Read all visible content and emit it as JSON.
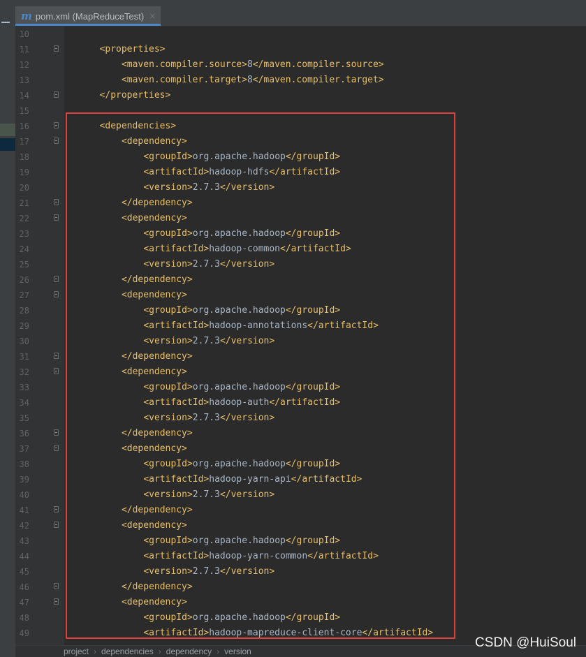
{
  "tab": {
    "icon": "m",
    "title": "pom.xml (MapReduceTest)",
    "close": "×"
  },
  "code_lines": [
    {
      "n": "10",
      "indent": 0,
      "parts": []
    },
    {
      "n": "11",
      "indent": 3,
      "fold": true,
      "parts": [
        {
          "t": "tag",
          "s": "<properties>"
        }
      ]
    },
    {
      "n": "12",
      "indent": 7,
      "parts": [
        {
          "t": "tag",
          "s": "<maven.compiler.source>"
        },
        {
          "t": "val",
          "s": "8"
        },
        {
          "t": "tag",
          "s": "</maven.compiler.source>"
        }
      ]
    },
    {
      "n": "13",
      "indent": 7,
      "parts": [
        {
          "t": "tag",
          "s": "<maven.compiler.target>"
        },
        {
          "t": "val",
          "s": "8"
        },
        {
          "t": "tag",
          "s": "</maven.compiler.target>"
        }
      ]
    },
    {
      "n": "14",
      "indent": 3,
      "fold": true,
      "parts": [
        {
          "t": "tag",
          "s": "</properties>"
        }
      ]
    },
    {
      "n": "15",
      "indent": 0,
      "parts": []
    },
    {
      "n": "16",
      "indent": 3,
      "fold": true,
      "parts": [
        {
          "t": "tag",
          "s": "<dependencies>"
        }
      ]
    },
    {
      "n": "17",
      "indent": 7,
      "fold": true,
      "parts": [
        {
          "t": "tag",
          "s": "<dependency>"
        }
      ]
    },
    {
      "n": "18",
      "indent": 11,
      "parts": [
        {
          "t": "tag",
          "s": "<groupId>"
        },
        {
          "t": "val",
          "s": "org.apache.hadoop"
        },
        {
          "t": "tag",
          "s": "</groupId>"
        }
      ]
    },
    {
      "n": "19",
      "indent": 11,
      "parts": [
        {
          "t": "tag",
          "s": "<artifactId>"
        },
        {
          "t": "val",
          "s": "hadoop-hdfs"
        },
        {
          "t": "tag",
          "s": "</artifactId>"
        }
      ]
    },
    {
      "n": "20",
      "indent": 11,
      "parts": [
        {
          "t": "tag",
          "s": "<version>"
        },
        {
          "t": "val",
          "s": "2.7.3"
        },
        {
          "t": "tag",
          "s": "</version>"
        }
      ]
    },
    {
      "n": "21",
      "indent": 7,
      "fold": true,
      "parts": [
        {
          "t": "tag",
          "s": "</dependency>"
        }
      ]
    },
    {
      "n": "22",
      "indent": 7,
      "fold": true,
      "parts": [
        {
          "t": "tag",
          "s": "<dependency>"
        }
      ]
    },
    {
      "n": "23",
      "indent": 11,
      "parts": [
        {
          "t": "tag",
          "s": "<groupId>"
        },
        {
          "t": "val",
          "s": "org.apache.hadoop"
        },
        {
          "t": "tag",
          "s": "</groupId>"
        }
      ]
    },
    {
      "n": "24",
      "indent": 11,
      "parts": [
        {
          "t": "tag",
          "s": "<artifactId>"
        },
        {
          "t": "val",
          "s": "hadoop-common"
        },
        {
          "t": "tag",
          "s": "</artifactId>"
        }
      ]
    },
    {
      "n": "25",
      "indent": 11,
      "parts": [
        {
          "t": "tag",
          "s": "<version>"
        },
        {
          "t": "val",
          "s": "2.7.3"
        },
        {
          "t": "tag",
          "s": "</version>"
        }
      ]
    },
    {
      "n": "26",
      "indent": 7,
      "fold": true,
      "parts": [
        {
          "t": "tag",
          "s": "</dependency>"
        }
      ]
    },
    {
      "n": "27",
      "indent": 7,
      "fold": true,
      "parts": [
        {
          "t": "tag",
          "s": "<dependency>"
        }
      ]
    },
    {
      "n": "28",
      "indent": 11,
      "parts": [
        {
          "t": "tag",
          "s": "<groupId>"
        },
        {
          "t": "val",
          "s": "org.apache.hadoop"
        },
        {
          "t": "tag",
          "s": "</groupId>"
        }
      ]
    },
    {
      "n": "29",
      "indent": 11,
      "parts": [
        {
          "t": "tag",
          "s": "<artifactId>"
        },
        {
          "t": "val",
          "s": "hadoop-annotations"
        },
        {
          "t": "tag",
          "s": "</artifactId>"
        }
      ]
    },
    {
      "n": "30",
      "indent": 11,
      "parts": [
        {
          "t": "tag",
          "s": "<version>"
        },
        {
          "t": "val",
          "s": "2.7.3"
        },
        {
          "t": "tag",
          "s": "</version>"
        }
      ]
    },
    {
      "n": "31",
      "indent": 7,
      "fold": true,
      "parts": [
        {
          "t": "tag",
          "s": "</dependency>"
        }
      ]
    },
    {
      "n": "32",
      "indent": 7,
      "fold": true,
      "parts": [
        {
          "t": "tag",
          "s": "<dependency>"
        }
      ]
    },
    {
      "n": "33",
      "indent": 11,
      "parts": [
        {
          "t": "tag",
          "s": "<groupId>"
        },
        {
          "t": "val",
          "s": "org.apache.hadoop"
        },
        {
          "t": "tag",
          "s": "</groupId>"
        }
      ]
    },
    {
      "n": "34",
      "indent": 11,
      "parts": [
        {
          "t": "tag",
          "s": "<artifactId>"
        },
        {
          "t": "val",
          "s": "hadoop-auth"
        },
        {
          "t": "tag",
          "s": "</artifactId>"
        }
      ]
    },
    {
      "n": "35",
      "indent": 11,
      "parts": [
        {
          "t": "tag",
          "s": "<version>"
        },
        {
          "t": "val",
          "s": "2.7.3"
        },
        {
          "t": "tag",
          "s": "</version>"
        }
      ]
    },
    {
      "n": "36",
      "indent": 7,
      "fold": true,
      "parts": [
        {
          "t": "tag",
          "s": "</dependency>"
        }
      ]
    },
    {
      "n": "37",
      "indent": 7,
      "fold": true,
      "parts": [
        {
          "t": "tag",
          "s": "<dependency>"
        }
      ]
    },
    {
      "n": "38",
      "indent": 11,
      "parts": [
        {
          "t": "tag",
          "s": "<groupId>"
        },
        {
          "t": "val",
          "s": "org.apache.hadoop"
        },
        {
          "t": "tag",
          "s": "</groupId>"
        }
      ]
    },
    {
      "n": "39",
      "indent": 11,
      "parts": [
        {
          "t": "tag",
          "s": "<artifactId>"
        },
        {
          "t": "val",
          "s": "hadoop-yarn-api"
        },
        {
          "t": "tag",
          "s": "</artifactId>"
        }
      ]
    },
    {
      "n": "40",
      "indent": 11,
      "parts": [
        {
          "t": "tag",
          "s": "<version>"
        },
        {
          "t": "val",
          "s": "2.7.3"
        },
        {
          "t": "tag",
          "s": "</version>"
        }
      ]
    },
    {
      "n": "41",
      "indent": 7,
      "fold": true,
      "parts": [
        {
          "t": "tag",
          "s": "</dependency>"
        }
      ]
    },
    {
      "n": "42",
      "indent": 7,
      "fold": true,
      "parts": [
        {
          "t": "tag",
          "s": "<dependency>"
        }
      ]
    },
    {
      "n": "43",
      "indent": 11,
      "parts": [
        {
          "t": "tag",
          "s": "<groupId>"
        },
        {
          "t": "val",
          "s": "org.apache.hadoop"
        },
        {
          "t": "tag",
          "s": "</groupId>"
        }
      ]
    },
    {
      "n": "44",
      "indent": 11,
      "parts": [
        {
          "t": "tag",
          "s": "<artifactId>"
        },
        {
          "t": "val",
          "s": "hadoop-yarn-common"
        },
        {
          "t": "tag",
          "s": "</artifactId>"
        }
      ]
    },
    {
      "n": "45",
      "indent": 11,
      "parts": [
        {
          "t": "tag",
          "s": "<version>"
        },
        {
          "t": "val",
          "s": "2.7.3"
        },
        {
          "t": "tag",
          "s": "</version>"
        }
      ]
    },
    {
      "n": "46",
      "indent": 7,
      "fold": true,
      "parts": [
        {
          "t": "tag",
          "s": "</dependency>"
        }
      ]
    },
    {
      "n": "47",
      "indent": 7,
      "fold": true,
      "parts": [
        {
          "t": "tag",
          "s": "<dependency>"
        }
      ]
    },
    {
      "n": "48",
      "indent": 11,
      "parts": [
        {
          "t": "tag",
          "s": "<groupId>"
        },
        {
          "t": "val",
          "s": "org.apache.hadoop"
        },
        {
          "t": "tag",
          "s": "</groupId>"
        }
      ]
    },
    {
      "n": "49",
      "indent": 11,
      "parts": [
        {
          "t": "tag",
          "s": "<artifactId>"
        },
        {
          "t": "val",
          "s": "hadoop-mapreduce-client-core"
        },
        {
          "t": "tag",
          "s": "</artifactId>"
        }
      ]
    }
  ],
  "breadcrumbs": [
    "project",
    "dependencies",
    "dependency",
    "version"
  ],
  "watermark": "CSDN @HuiSoul",
  "colors": {
    "tag": "#e8bf6a",
    "text": "#a9b7c6",
    "background": "#2b2b2b",
    "highlight": "#e0403c",
    "accent": "#4a88c7"
  }
}
